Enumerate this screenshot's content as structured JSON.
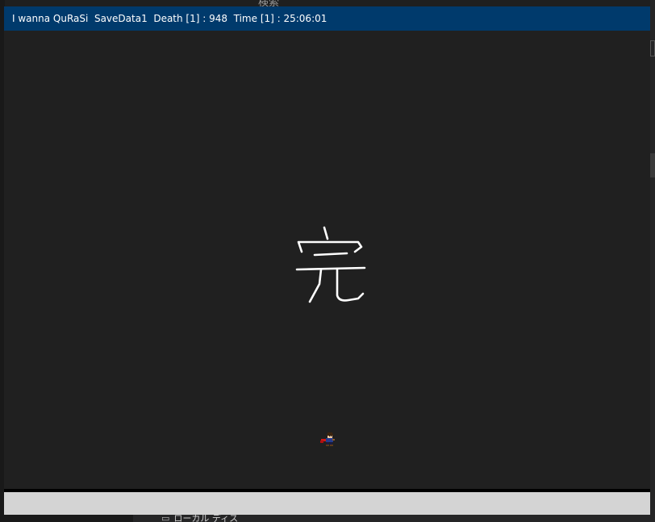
{
  "window": {
    "title": "I wanna QuRaSi  SaveData1  Death [1] : 948  Time [1] : 25:06:01"
  },
  "game": {
    "center_text": "完",
    "player": "kid-player-sprite"
  },
  "background": {
    "search_label": "検索",
    "drive_label": "ローカル ディス",
    "drive_icon": "drive-icon"
  },
  "colors": {
    "title_bar": "#003a6c",
    "canvas": "#202020",
    "status_bar": "#d4d4d4"
  }
}
